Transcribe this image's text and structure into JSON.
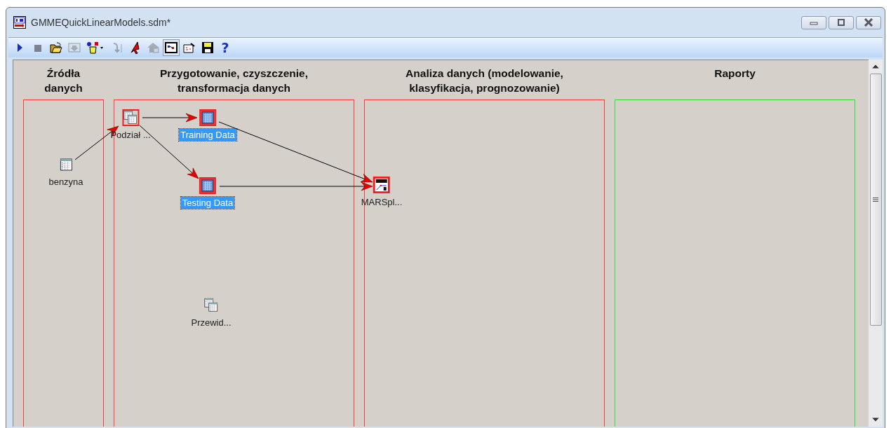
{
  "window": {
    "title": "GMMEQuickLinearModels.sdm*"
  },
  "toolbar": [
    {
      "kind": "run",
      "disabled": false,
      "pressed": false
    },
    {
      "kind": "stop",
      "disabled": true,
      "pressed": false
    },
    {
      "kind": "open",
      "disabled": false,
      "pressed": false
    },
    {
      "kind": "import",
      "disabled": true,
      "pressed": false
    },
    {
      "kind": "nodes",
      "disabled": false,
      "pressed": false
    },
    {
      "kind": "step",
      "disabled": true,
      "pressed": false
    },
    {
      "kind": "pointer",
      "disabled": false,
      "pressed": false
    },
    {
      "kind": "home",
      "disabled": true,
      "pressed": false
    },
    {
      "kind": "workspace",
      "disabled": false,
      "pressed": true
    },
    {
      "kind": "report",
      "disabled": false,
      "pressed": false
    },
    {
      "kind": "save",
      "disabled": false,
      "pressed": false
    },
    {
      "kind": "help",
      "disabled": false,
      "pressed": false,
      "label": "?"
    }
  ],
  "lanes": [
    {
      "title": "Źródła danych",
      "color": "#ff3b3b"
    },
    {
      "title": "Przygotowanie, czyszczenie, transformacja danych",
      "color": "#ff3b3b"
    },
    {
      "title": "Analiza danych (modelowanie, klasyfikacja, prognozowanie)",
      "color": "#ff3b3b"
    },
    {
      "title": "Raporty",
      "color": "#33dd33"
    }
  ],
  "nodes": [
    {
      "label": "benzyna",
      "kind": "table",
      "marked": false,
      "selected": false
    },
    {
      "label": "Podział ...",
      "kind": "split",
      "marked": true,
      "selected": false
    },
    {
      "label": "Training Data",
      "kind": "table",
      "marked": true,
      "selected": true
    },
    {
      "label": "Testing Data",
      "kind": "table",
      "marked": true,
      "selected": true
    },
    {
      "label": "MARSpl...",
      "kind": "mars",
      "marked": true,
      "selected": false
    },
    {
      "label": "Przewid...",
      "kind": "split",
      "marked": false,
      "selected": false
    }
  ]
}
